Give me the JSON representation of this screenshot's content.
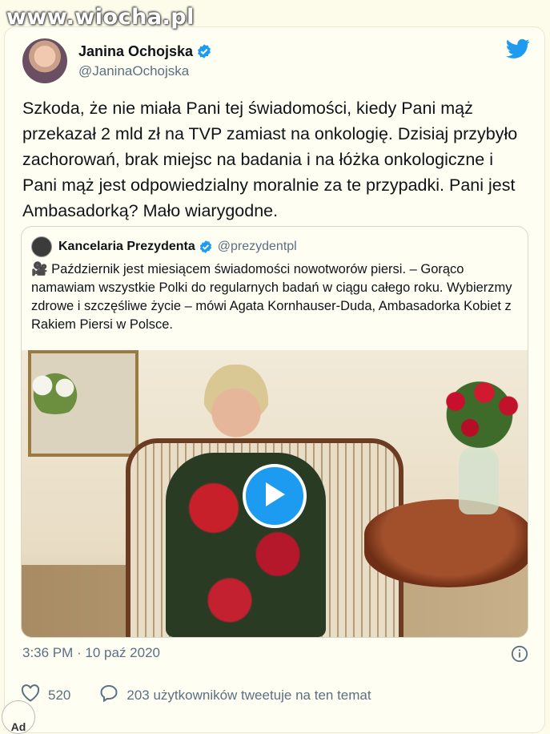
{
  "watermark": "www.wiocha.pl",
  "tweet": {
    "author_name": "Janina Ochojska",
    "author_handle": "@JaninaOchojska",
    "text": "Szkoda, że nie miała Pani tej świadomości, kiedy Pani mąż przekazał 2 mld zł na TVP zamiast na onkologię. Dzisiaj przybyło zachorowań, brak miejsc na badania i na łóżka onkologiczne i Pani mąż jest odpowiedzialny moralnie za te przypadki. Pani jest Ambasadorką? Mało wiarygodne.",
    "timestamp": "3:36 PM · 10 paź 2020",
    "likes": "520",
    "replies_label": "203 użytkowników tweetuje na ten temat"
  },
  "quoted": {
    "author_name": "Kancelaria Prezydenta",
    "author_handle": "@prezydentpl",
    "text": "🎥 Październik jest miesiącem świadomości nowotworów piersi. – Gorąco namawiam wszystkie Polki do regularnych badań w ciągu całego roku. Wybierzmy zdrowe i szczęśliwe życie – mówi Agata Kornhauser-Duda, Ambasadorka Kobiet z Rakiem Piersi w Polsce."
  },
  "corner_badge": "Ad",
  "colors": {
    "accent": "#1d9bf0",
    "secondary_text": "#5b7083",
    "background": "#fdfcea"
  },
  "icons": [
    "verified-badge-icon",
    "twitter-bird-icon",
    "play-icon",
    "info-icon",
    "heart-icon",
    "comment-icon"
  ]
}
